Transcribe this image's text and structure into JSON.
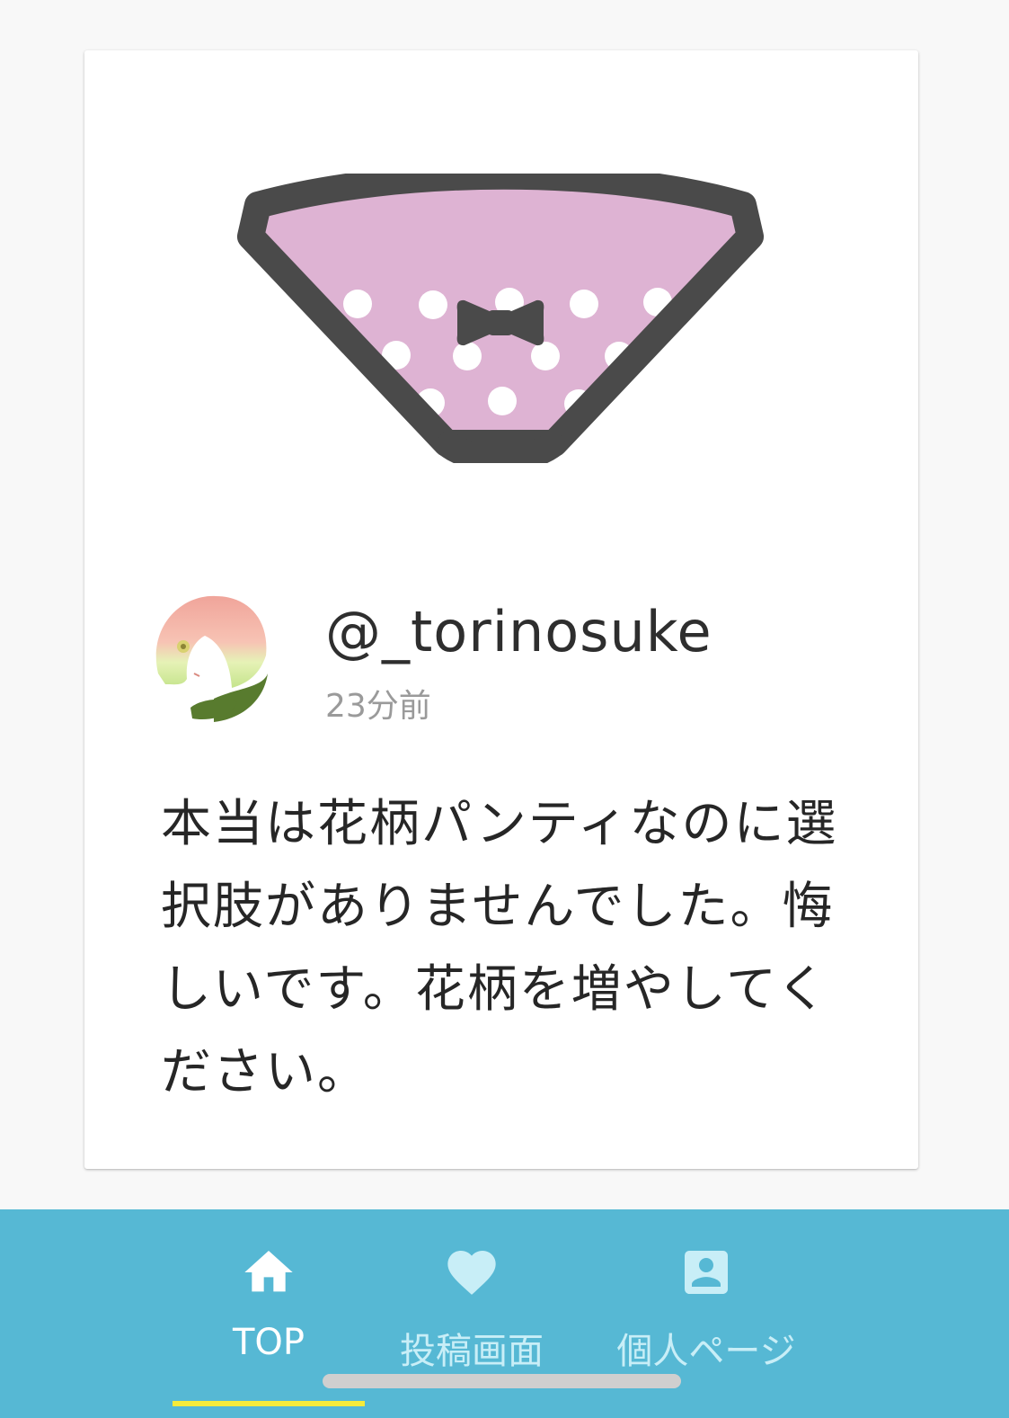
{
  "post": {
    "username": "@_torinosuke",
    "timestamp": "23分前",
    "text": "本当は花柄パンティなのに選択肢がありませんでした。悔しいです。花柄を増やしてください。",
    "image_icon": "polka-dot-panty-illustration",
    "avatar_icon": "anime-girl-avatar"
  },
  "nav": {
    "items": [
      {
        "label": "TOP",
        "icon": "home-icon",
        "active": true
      },
      {
        "label": "投稿画面",
        "icon": "heart-icon",
        "active": false
      },
      {
        "label": "個人ページ",
        "icon": "account-box-icon",
        "active": false
      }
    ]
  },
  "colors": {
    "nav_background": "#56b8d4",
    "active_indicator": "#f6eb3a",
    "inactive_nav": "#c8eef7",
    "panty_fill": "#deb3d3",
    "panty_outline": "#4a4a4a"
  }
}
